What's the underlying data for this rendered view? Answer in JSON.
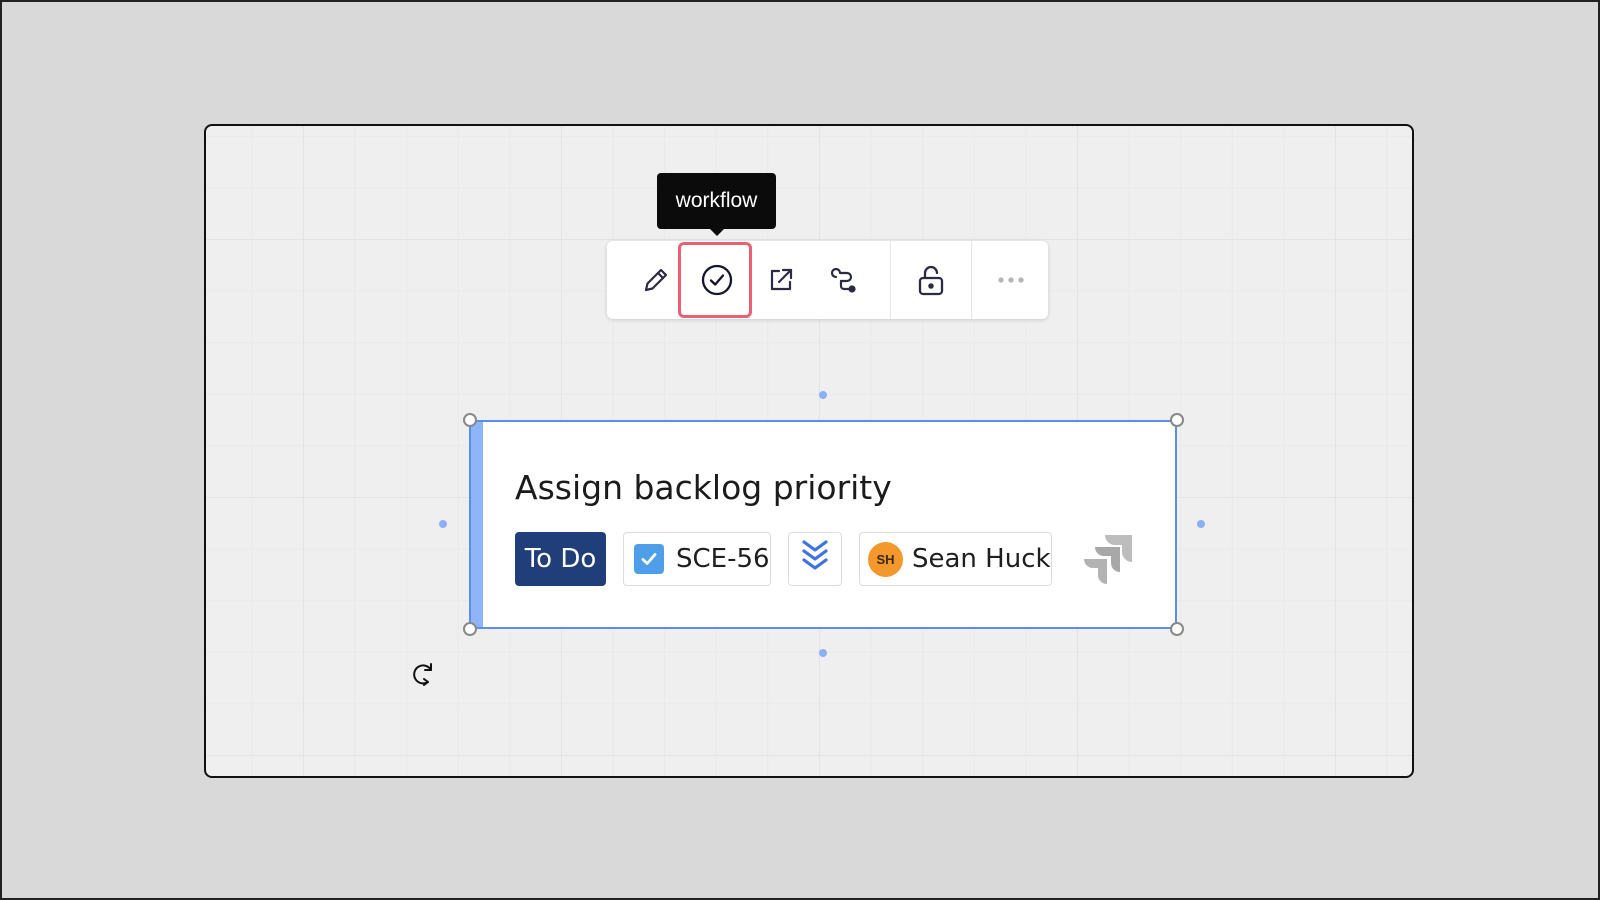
{
  "tooltip": {
    "text": "workflow"
  },
  "toolbar": {
    "items": [
      {
        "name": "edit",
        "icon": "pencil-icon"
      },
      {
        "name": "workflow",
        "icon": "check-circle-icon",
        "highlighted": true
      },
      {
        "name": "open-link",
        "icon": "external-link-icon"
      },
      {
        "name": "connect",
        "icon": "connector-icon"
      },
      {
        "name": "lock",
        "icon": "unlock-icon"
      },
      {
        "name": "more",
        "icon": "more-icon"
      }
    ],
    "highlight_color": "#ec5f73"
  },
  "card": {
    "title": "Assign backlog priority",
    "status": "To Do",
    "issue_key": "SCE-56",
    "priority_icon": "priority-lowest-icon",
    "assignee": {
      "initials": "SH",
      "name": "Sean Huck"
    },
    "logo_icon": "jira-logo-icon",
    "selection_color": "#5b8ef0"
  },
  "colors": {
    "status_bg": "#1f3e7a",
    "avatar_bg": "#f4972c",
    "checkbox_bg": "#4f9fe8"
  }
}
